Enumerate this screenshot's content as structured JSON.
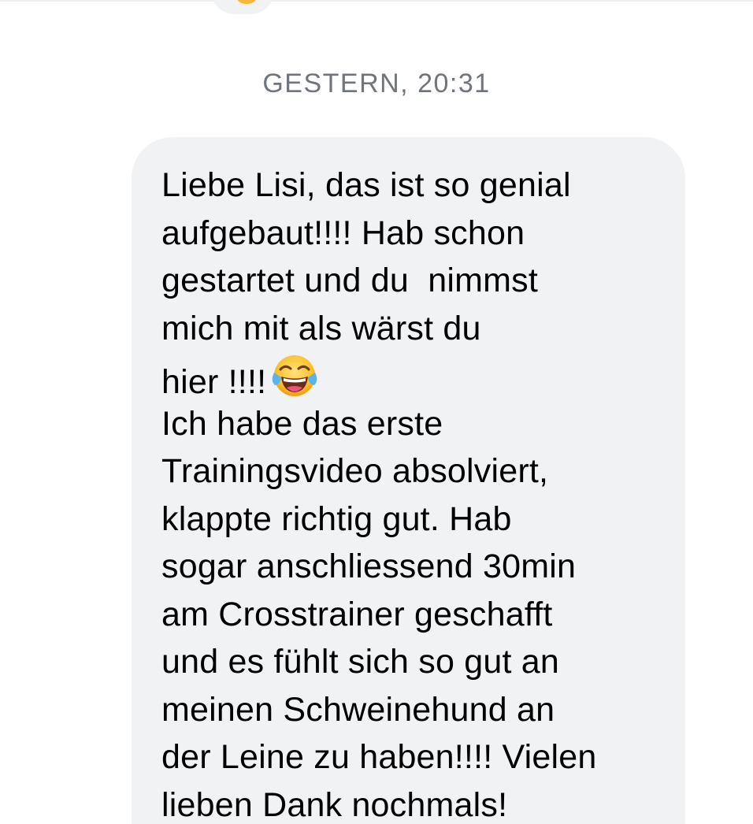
{
  "conversation": {
    "timestamp": "GESTERN, 20:31"
  },
  "message": {
    "lines": [
      "Liebe Lisi, das ist so genial",
      "aufgebaut!!!! Hab schon",
      "gestartet und du  nimmst",
      "mich mit als wärst du",
      "hier !!!!",
      "Ich habe das erste",
      "Trainingsvideo absolviert,",
      "klappte richtig gut. Hab",
      "sogar anschliessend 30min",
      "am Crosstrainer geschafft",
      "und es fühlt sich so gut an",
      "meinen Schweinehund an",
      "der Leine zu haben!!!! Vielen",
      "lieben Dank nochmals!"
    ],
    "emoji": "face-with-tears-of-joy-icon"
  },
  "colors": {
    "bubble_background": "#f1f2f4",
    "timestamp_text": "#70747b",
    "message_text": "#000000"
  }
}
